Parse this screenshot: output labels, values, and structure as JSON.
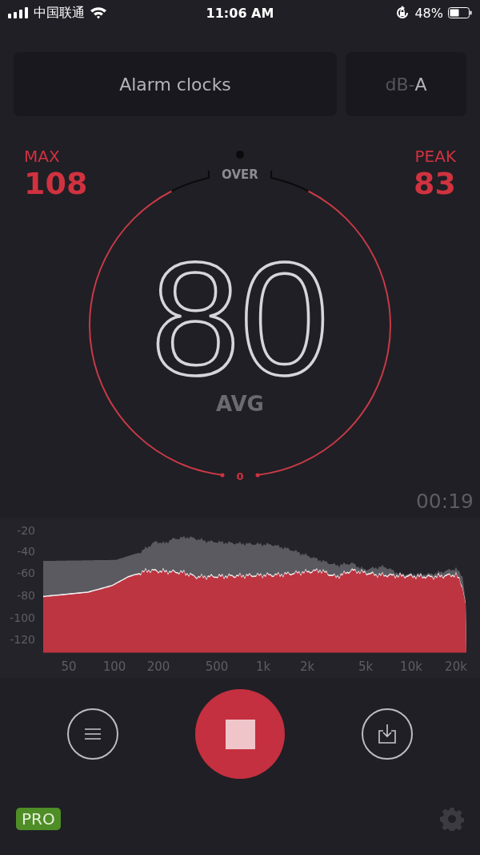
{
  "status_bar": {
    "carrier": "中国联通",
    "time": "11:06 AM",
    "battery": "48%"
  },
  "category_button": {
    "label": "Alarm clocks"
  },
  "weighting_button": {
    "prefix": "dB-",
    "weighting": "A"
  },
  "max": {
    "label": "MAX",
    "value": "108"
  },
  "peak": {
    "label": "PEAK",
    "value": "83"
  },
  "gauge": {
    "over_label": "OVER",
    "value": "80",
    "value_label": "AVG",
    "zero_label": "0"
  },
  "elapsed": "00:19",
  "spectrum": {
    "y_labels": [
      "-20",
      "-40",
      "-60",
      "-80",
      "-100",
      "-120"
    ],
    "x_labels": [
      "50",
      "100",
      "200",
      "500",
      "1k",
      "2k",
      "5k",
      "10k",
      "20k"
    ]
  },
  "controls": [
    {
      "kind": "menu"
    },
    {
      "kind": "stop"
    },
    {
      "kind": "export"
    }
  ],
  "pro_badge": "PRO"
}
